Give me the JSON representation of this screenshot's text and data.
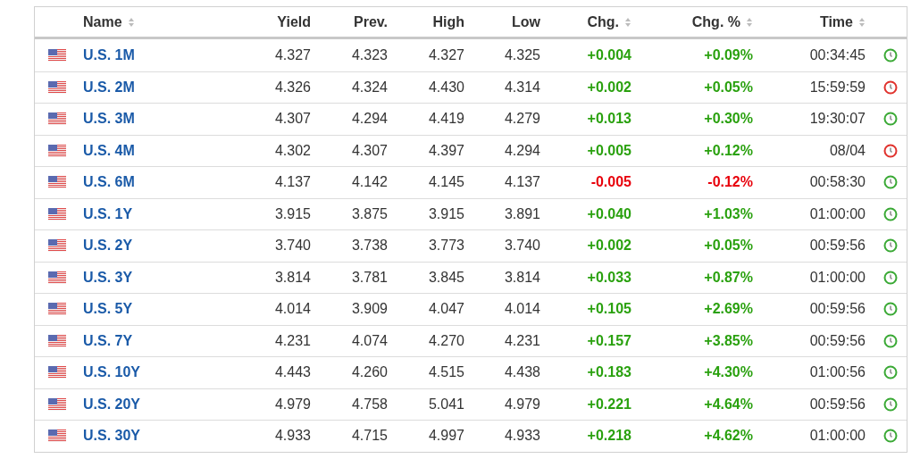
{
  "table": {
    "columns": [
      {
        "label": "Name",
        "sortable": true
      },
      {
        "label": "Yield",
        "sortable": false
      },
      {
        "label": "Prev.",
        "sortable": false
      },
      {
        "label": "High",
        "sortable": false
      },
      {
        "label": "Low",
        "sortable": false
      },
      {
        "label": "Chg.",
        "sortable": true
      },
      {
        "label": "Chg. %",
        "sortable": true
      },
      {
        "label": "Time",
        "sortable": true
      }
    ],
    "rows": [
      {
        "name": "U.S. 1M",
        "yield": "4.327",
        "prev": "4.323",
        "high": "4.327",
        "low": "4.325",
        "chg": "+0.004",
        "chg_pct": "+0.09%",
        "kind": "gain",
        "time": "00:34:45",
        "color": "#3aa935"
      },
      {
        "name": "U.S. 2M",
        "yield": "4.326",
        "prev": "4.324",
        "high": "4.430",
        "low": "4.314",
        "chg": "+0.002",
        "chg_pct": "+0.05%",
        "kind": "gain",
        "time": "15:59:59",
        "color": "#e0322d"
      },
      {
        "name": "U.S. 3M",
        "yield": "4.307",
        "prev": "4.294",
        "high": "4.419",
        "low": "4.279",
        "chg": "+0.013",
        "chg_pct": "+0.30%",
        "kind": "gain",
        "time": "19:30:07",
        "color": "#3aa935"
      },
      {
        "name": "U.S. 4M",
        "yield": "4.302",
        "prev": "4.307",
        "high": "4.397",
        "low": "4.294",
        "chg": "+0.005",
        "chg_pct": "+0.12%",
        "kind": "gain",
        "time": "08/04",
        "color": "#e0322d"
      },
      {
        "name": "U.S. 6M",
        "yield": "4.137",
        "prev": "4.142",
        "high": "4.145",
        "low": "4.137",
        "chg": "-0.005",
        "chg_pct": "-0.12%",
        "kind": "loss",
        "time": "00:58:30",
        "color": "#3aa935"
      },
      {
        "name": "U.S. 1Y",
        "yield": "3.915",
        "prev": "3.875",
        "high": "3.915",
        "low": "3.891",
        "chg": "+0.040",
        "chg_pct": "+1.03%",
        "kind": "gain",
        "time": "01:00:00",
        "color": "#3aa935"
      },
      {
        "name": "U.S. 2Y",
        "yield": "3.740",
        "prev": "3.738",
        "high": "3.773",
        "low": "3.740",
        "chg": "+0.002",
        "chg_pct": "+0.05%",
        "kind": "gain",
        "time": "00:59:56",
        "color": "#3aa935"
      },
      {
        "name": "U.S. 3Y",
        "yield": "3.814",
        "prev": "3.781",
        "high": "3.845",
        "low": "3.814",
        "chg": "+0.033",
        "chg_pct": "+0.87%",
        "kind": "gain",
        "time": "01:00:00",
        "color": "#3aa935"
      },
      {
        "name": "U.S. 5Y",
        "yield": "4.014",
        "prev": "3.909",
        "high": "4.047",
        "low": "4.014",
        "chg": "+0.105",
        "chg_pct": "+2.69%",
        "kind": "gain",
        "time": "00:59:56",
        "color": "#3aa935"
      },
      {
        "name": "U.S. 7Y",
        "yield": "4.231",
        "prev": "4.074",
        "high": "4.270",
        "low": "4.231",
        "chg": "+0.157",
        "chg_pct": "+3.85%",
        "kind": "gain",
        "time": "00:59:56",
        "color": "#3aa935"
      },
      {
        "name": "U.S. 10Y",
        "yield": "4.443",
        "prev": "4.260",
        "high": "4.515",
        "low": "4.438",
        "chg": "+0.183",
        "chg_pct": "+4.30%",
        "kind": "gain",
        "time": "01:00:56",
        "color": "#3aa935"
      },
      {
        "name": "U.S. 20Y",
        "yield": "4.979",
        "prev": "4.758",
        "high": "5.041",
        "low": "4.979",
        "chg": "+0.221",
        "chg_pct": "+4.64%",
        "kind": "gain",
        "time": "00:59:56",
        "color": "#3aa935"
      },
      {
        "name": "U.S. 30Y",
        "yield": "4.933",
        "prev": "4.715",
        "high": "4.997",
        "low": "4.933",
        "chg": "+0.218",
        "chg_pct": "+4.62%",
        "kind": "gain",
        "time": "01:00:00",
        "color": "#3aa935"
      }
    ]
  }
}
